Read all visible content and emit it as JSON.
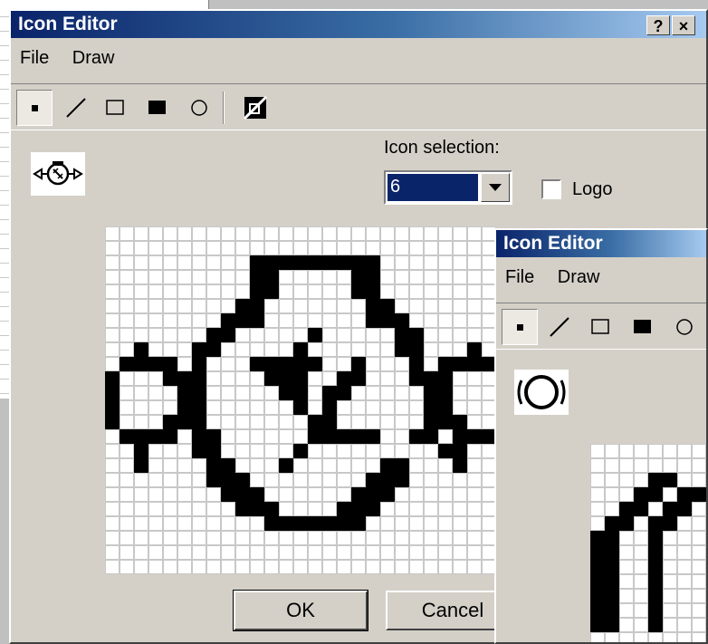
{
  "main_window": {
    "title": "Icon Editor",
    "help_button": "?",
    "close_button": "×",
    "menu": [
      "File",
      "Draw"
    ],
    "tools": [
      "pixel-tool",
      "line-tool",
      "rectangle-tool",
      "filled-rectangle-tool",
      "ellipse-tool",
      "invert-tool"
    ],
    "icon_selection_label": "Icon selection:",
    "icon_selection_value": "6",
    "logo_label": "Logo",
    "logo_checked": false,
    "ok_label": "OK",
    "cancel_label": "Cancel",
    "pixel_rows": [
      "...........................",
      "...........................",
      "..........#########........",
      "..........##.....##........",
      "..........##.....##........",
      ".........##.......##.......",
      "........###.......###......",
      ".......##.....#.....##.....",
      "..#...##.....#......##...#.",
      ".####.#...#####..#...#.####",
      "#...###....###..##...###...",
      "#....##.....##.##.....##...",
      "#....##......#.#......##...",
      "#...###.......##......###..",
      ".####.##......#####..##.###",
      "..#...##.....#.........##..",
      "..#....##...#......##...#..",
      ".......###........###......",
      "........###......###.......",
      ".........###....###........",
      "...........#######.........",
      "...........................",
      "...........................",
      "..........................."
    ]
  },
  "second_window": {
    "title": "Icon Editor",
    "menu": [
      "File",
      "Draw"
    ],
    "tools": [
      "pixel-tool",
      "line-tool",
      "rectangle-tool",
      "filled-rectangle-tool",
      "ellipse-tool"
    ],
    "pixel_rows": [
      "........",
      "........",
      "....##..",
      "...##.##",
      "..##.##.",
      ".##.##..",
      "##..#...",
      "##..#...",
      "##..#...",
      "##..#...",
      "##..#...",
      "##..#...",
      "##..#..."
    ]
  },
  "colors": {
    "title_start": "#0a246a",
    "title_end": "#a6caf0",
    "face": "#d4d0c8",
    "selection": "#0a246a"
  }
}
